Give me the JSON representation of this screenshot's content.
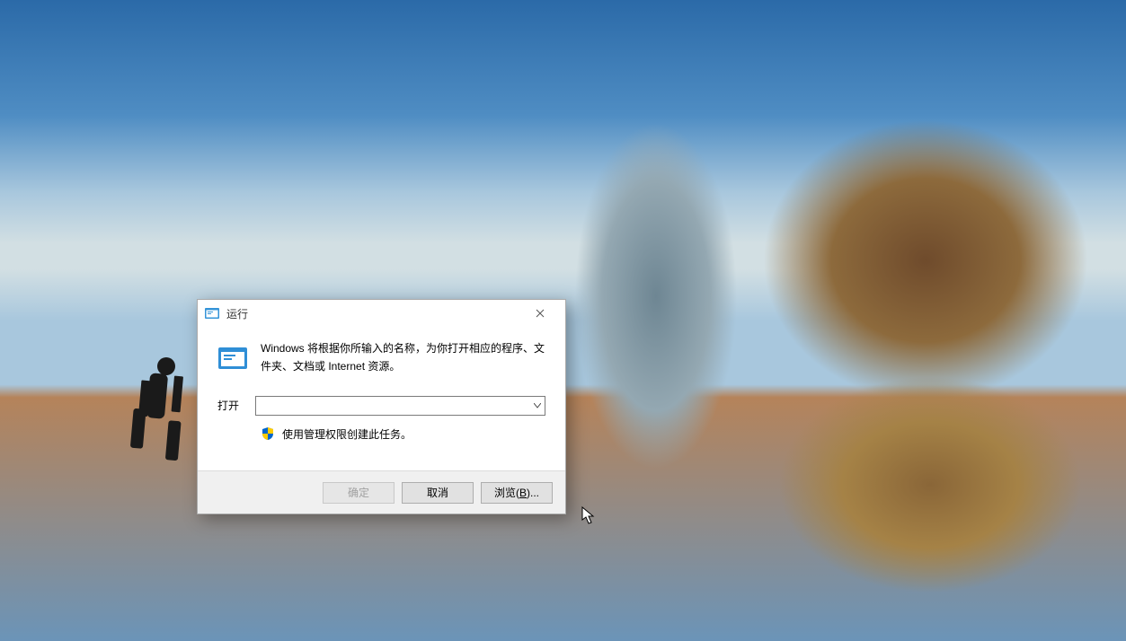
{
  "dialog": {
    "title": "运行",
    "description": "Windows 将根据你所输入的名称，为你打开相应的程序、文件夹、文档或 Internet 资源。",
    "open_label": "打开",
    "input_value": "",
    "admin_label": "使用管理权限创建此任务。",
    "buttons": {
      "ok": "确定",
      "cancel": "取消",
      "browse_prefix": "浏览(",
      "browse_key": "B",
      "browse_suffix": ")..."
    }
  },
  "icons": {
    "app": "run-icon",
    "shield": "shield-icon",
    "close": "close-icon"
  }
}
